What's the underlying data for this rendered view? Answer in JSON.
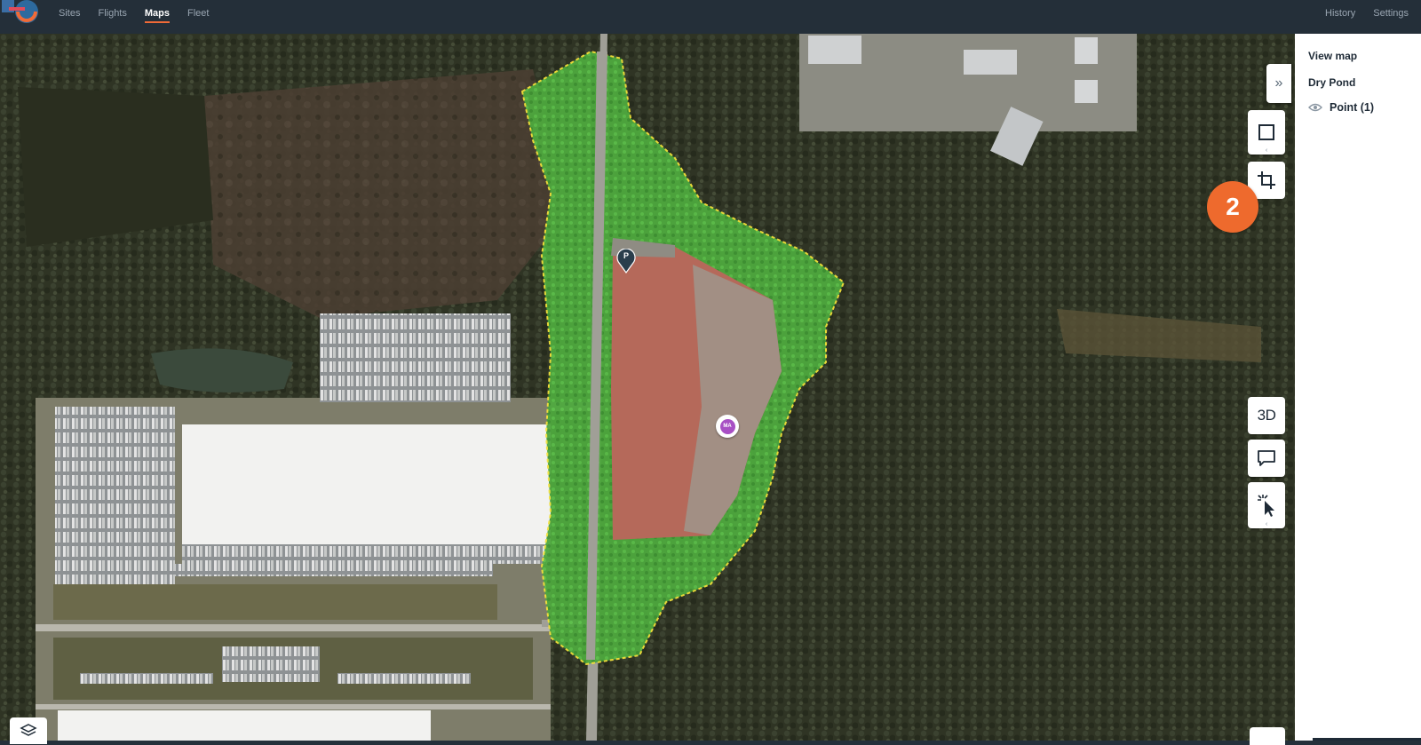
{
  "nav": {
    "items": [
      {
        "label": "Sites",
        "active": false
      },
      {
        "label": "Flights",
        "active": false
      },
      {
        "label": "Maps",
        "active": true
      },
      {
        "label": "Fleet",
        "active": false
      }
    ],
    "right": [
      "History",
      "Settings"
    ]
  },
  "panel": {
    "title": "View map",
    "layer_name": "Dry Pond",
    "point_label": "Point (1)"
  },
  "map": {
    "pin_label": "P",
    "marker_initials": "MA"
  },
  "tools": {
    "threed_label": "3D"
  },
  "badge": "2",
  "colors": {
    "accent": "#ee6a2d",
    "polygon_fill": "#3fbf3f",
    "polygon_outline": "#f3e13a",
    "topbar": "#242f39"
  },
  "icons": [
    "app-logo-icon",
    "expand-panel-icon",
    "square-select-icon",
    "crop-icon",
    "comment-icon",
    "cursor-click-icon",
    "layers-icon",
    "eye-icon",
    "map-pin-icon"
  ]
}
